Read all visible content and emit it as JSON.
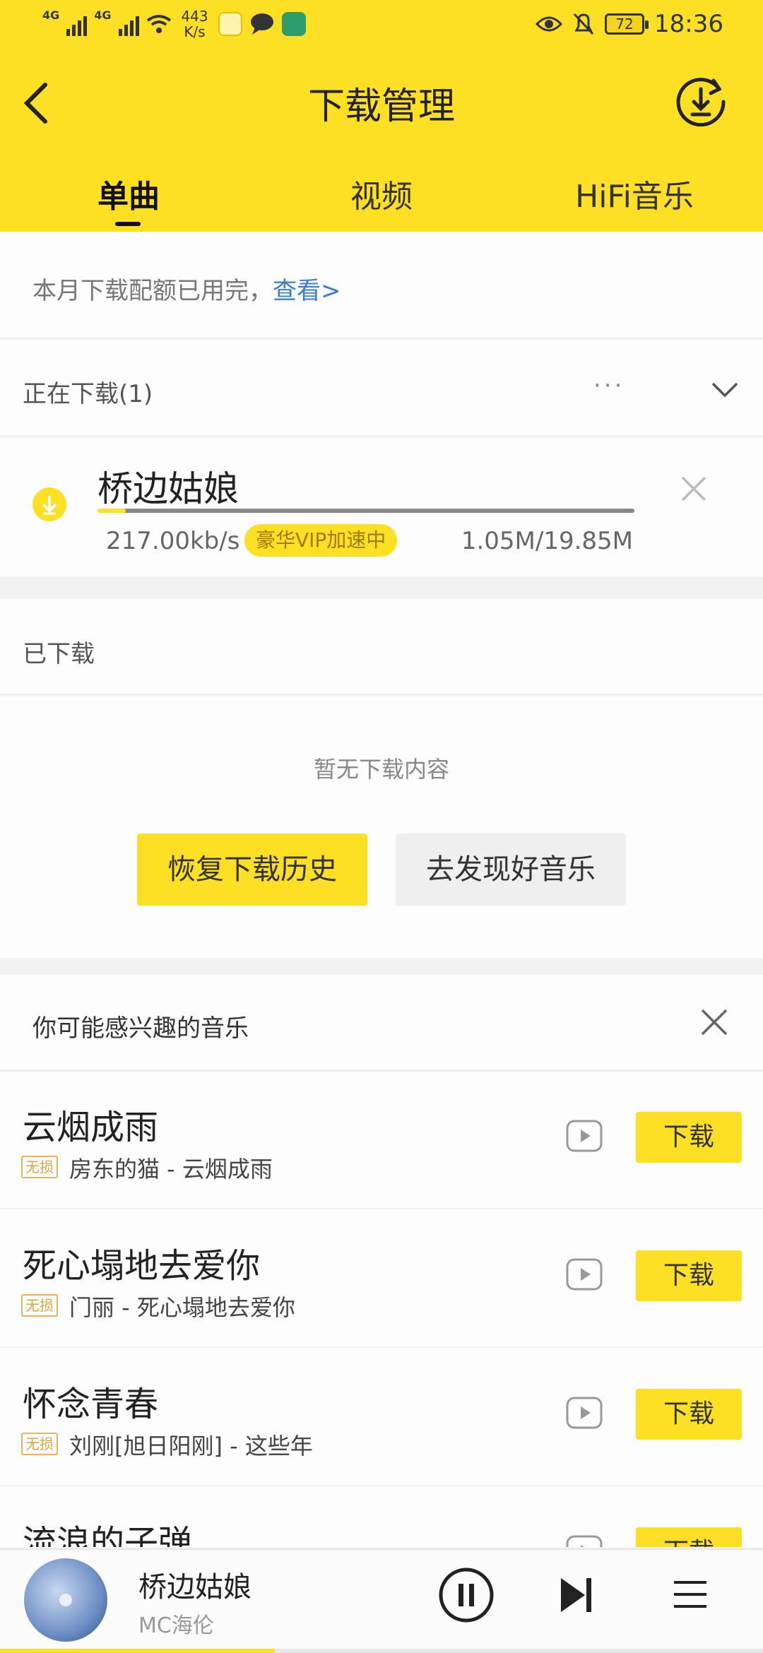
{
  "status_bar": {
    "network_1": "4G",
    "network_2": "4G",
    "net_speed_value": "443",
    "net_speed_unit": "K/s",
    "battery": "72",
    "time": "18:36"
  },
  "nav": {
    "title": "下载管理"
  },
  "tabs": [
    {
      "label": "单曲",
      "active": true
    },
    {
      "label": "视频",
      "active": false
    },
    {
      "label": "HiFi音乐",
      "active": false
    }
  ],
  "quota": {
    "text": "本月下载配额已用完，",
    "link": "查看>"
  },
  "downloading": {
    "section_label": "正在下载(1)",
    "more": "···",
    "item": {
      "name": "桥边姑娘",
      "speed": "217.00kb/s",
      "vip_badge": "豪华VIP加速中",
      "size": "1.05M/19.85M",
      "progress_fraction": 0.053
    }
  },
  "downloaded": {
    "section_label": "已下载",
    "empty_text": "暂无下载内容",
    "restore_button": "恢复下载历史",
    "discover_button": "去发现好音乐"
  },
  "recommend": {
    "title": "你可能感兴趣的音乐",
    "songs": [
      {
        "title": "云烟成雨",
        "tag": "无损",
        "subtitle": "房东的猫 - 云烟成雨",
        "download_label": "下载"
      },
      {
        "title": "死心塌地去爱你",
        "tag": "无损",
        "subtitle": "门丽 - 死心塌地去爱你",
        "download_label": "下载"
      },
      {
        "title": "怀念青春",
        "tag": "无损",
        "subtitle": "刘刚[旭日阳刚] - 这些年",
        "download_label": "下载"
      },
      {
        "title": "流浪的子弹",
        "tag": "",
        "subtitle": "",
        "download_label": "下载"
      }
    ]
  },
  "player": {
    "title": "桥边姑娘",
    "artist": "MC海伦",
    "progress_fraction": 0.36
  },
  "colors": {
    "brand_yellow": "#fde023",
    "link_blue": "#3a7bd5"
  }
}
